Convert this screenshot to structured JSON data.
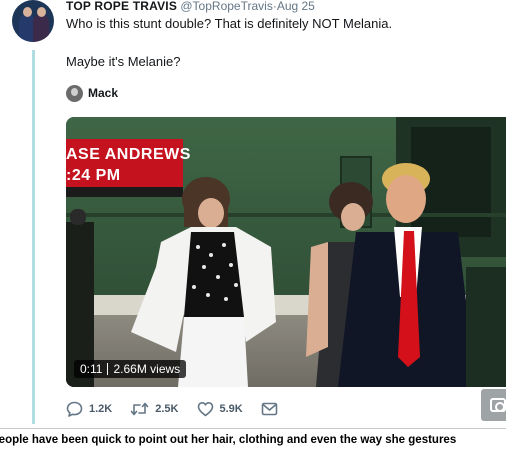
{
  "tweet": {
    "display_name": "TOP ROPE TRAVIS",
    "handle": "@TopRopeTravis",
    "separator": "·",
    "date": "Aug 25",
    "text_line1": "Who is this stunt double? That is definitely NOT Melania.",
    "text_line2": "Maybe it's Melanie?",
    "mention_name": "Mack"
  },
  "video": {
    "chyron_line1": "ASE ANDREWS",
    "chyron_line2": ":24 PM",
    "chyron_color": "#c4121f",
    "duration": "0:11",
    "views": "2.66M views"
  },
  "actions": {
    "reply_count": "1.2K",
    "retweet_count": "2.5K",
    "like_count": "5.9K",
    "icons": [
      "reply-icon",
      "retweet-icon",
      "like-icon",
      "message-icon"
    ]
  },
  "caption": {
    "text": "People have been quick to point out her hair, clothing and even the way she gestures"
  },
  "colors": {
    "thread_line": "#b0dde2",
    "action_gray": "#657786",
    "text_dark": "#14171a"
  }
}
